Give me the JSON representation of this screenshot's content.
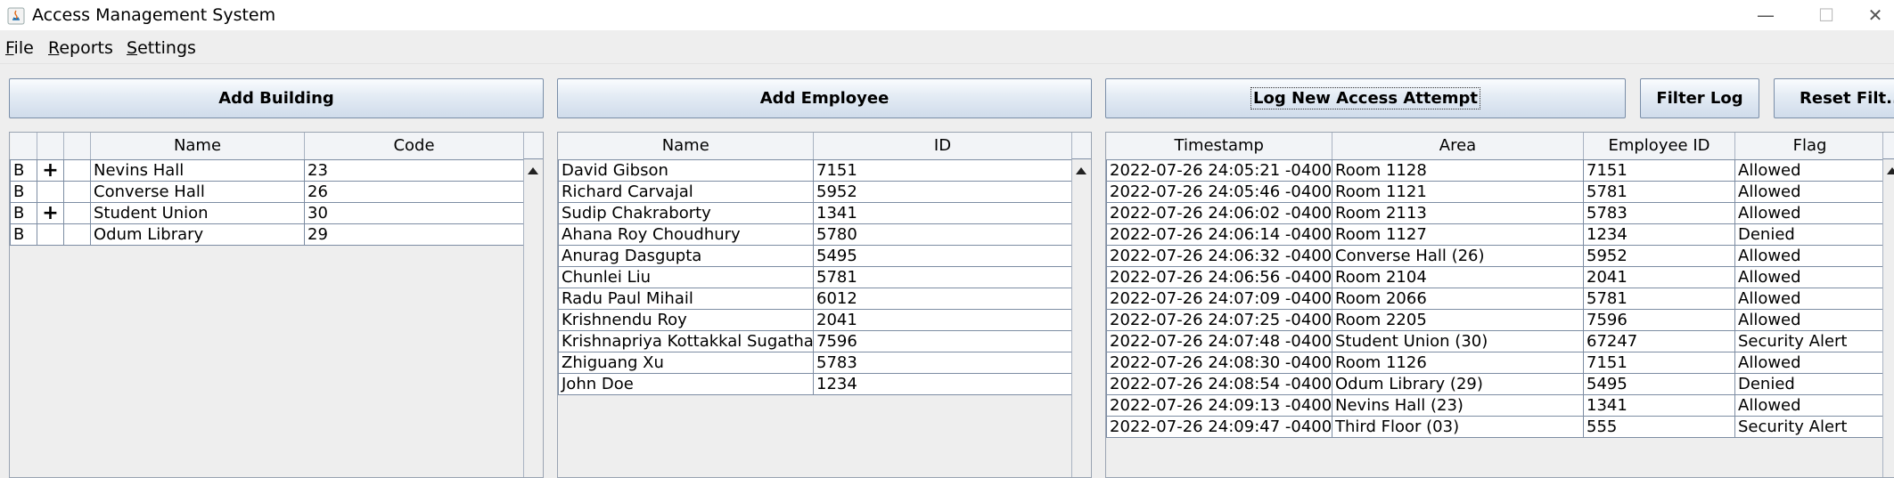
{
  "window": {
    "title": "Access Management System",
    "minimize_glyph": "—",
    "maximize_glyph": "☐",
    "close_glyph": "✕"
  },
  "menu": {
    "file_mnemonic": "F",
    "file_rest": "ile",
    "reports_mnemonic": "R",
    "reports_rest": "eports",
    "settings_mnemonic": "S",
    "settings_rest": "ettings"
  },
  "buttons": {
    "add_building": "Add Building",
    "add_employee": "Add Employee",
    "log_new_access_attempt": "Log New Access Attempt",
    "filter_log": "Filter Log",
    "reset_filter": "Reset Filt..."
  },
  "buildings": {
    "headers": [
      "",
      "",
      "",
      "Name",
      "Code"
    ],
    "rows": [
      {
        "type": "B",
        "expand": "+",
        "name": "Nevins Hall",
        "code": "23"
      },
      {
        "type": "B",
        "expand": "",
        "name": "Converse Hall",
        "code": "26"
      },
      {
        "type": "B",
        "expand": "+",
        "name": "Student Union",
        "code": "30"
      },
      {
        "type": "B",
        "expand": "",
        "name": "Odum Library",
        "code": "29"
      }
    ]
  },
  "employees": {
    "headers": [
      "Name",
      "ID"
    ],
    "rows": [
      {
        "name": "David Gibson",
        "id": "7151"
      },
      {
        "name": "Richard Carvajal",
        "id": "5952"
      },
      {
        "name": "Sudip Chakraborty",
        "id": "1341"
      },
      {
        "name": "Ahana Roy Choudhury",
        "id": "5780"
      },
      {
        "name": "Anurag Dasgupta",
        "id": "5495"
      },
      {
        "name": "Chunlei Liu",
        "id": "5781"
      },
      {
        "name": "Radu Paul Mihail",
        "id": "6012"
      },
      {
        "name": "Krishnendu Roy",
        "id": "2041"
      },
      {
        "name": "Krishnapriya Kottakkal Sugathan",
        "id": "7596"
      },
      {
        "name": "Zhiguang Xu",
        "id": "5783"
      },
      {
        "name": "John Doe",
        "id": "1234"
      }
    ]
  },
  "log": {
    "headers": [
      "Timestamp",
      "Area",
      "Employee ID",
      "Flag"
    ],
    "rows": [
      {
        "timestamp": "2022-07-26 24:05:21 -0400",
        "area": "Room 1128",
        "employee_id": "7151",
        "flag": "Allowed"
      },
      {
        "timestamp": "2022-07-26 24:05:46 -0400",
        "area": "Room 1121",
        "employee_id": "5781",
        "flag": "Allowed"
      },
      {
        "timestamp": "2022-07-26 24:06:02 -0400",
        "area": "Room 2113",
        "employee_id": "5783",
        "flag": "Allowed"
      },
      {
        "timestamp": "2022-07-26 24:06:14 -0400",
        "area": "Room 1127",
        "employee_id": "1234",
        "flag": "Denied"
      },
      {
        "timestamp": "2022-07-26 24:06:32 -0400",
        "area": "Converse Hall (26)",
        "employee_id": "5952",
        "flag": "Allowed"
      },
      {
        "timestamp": "2022-07-26 24:06:56 -0400",
        "area": "Room 2104",
        "employee_id": "2041",
        "flag": "Allowed"
      },
      {
        "timestamp": "2022-07-26 24:07:09 -0400",
        "area": "Room 2066",
        "employee_id": "5781",
        "flag": "Allowed"
      },
      {
        "timestamp": "2022-07-26 24:07:25 -0400",
        "area": "Room 2205",
        "employee_id": "7596",
        "flag": "Allowed"
      },
      {
        "timestamp": "2022-07-26 24:07:48 -0400",
        "area": "Student Union (30)",
        "employee_id": "67247",
        "flag": "Security Alert"
      },
      {
        "timestamp": "2022-07-26 24:08:30 -0400",
        "area": "Room 1126",
        "employee_id": "7151",
        "flag": "Allowed"
      },
      {
        "timestamp": "2022-07-26 24:08:54 -0400",
        "area": "Odum Library (29)",
        "employee_id": "5495",
        "flag": "Denied"
      },
      {
        "timestamp": "2022-07-26 24:09:13 -0400",
        "area": "Nevins Hall (23)",
        "employee_id": "1341",
        "flag": "Allowed"
      },
      {
        "timestamp": "2022-07-26 24:09:47 -0400",
        "area": "Third Floor (03)",
        "employee_id": "555",
        "flag": "Security Alert"
      }
    ]
  }
}
